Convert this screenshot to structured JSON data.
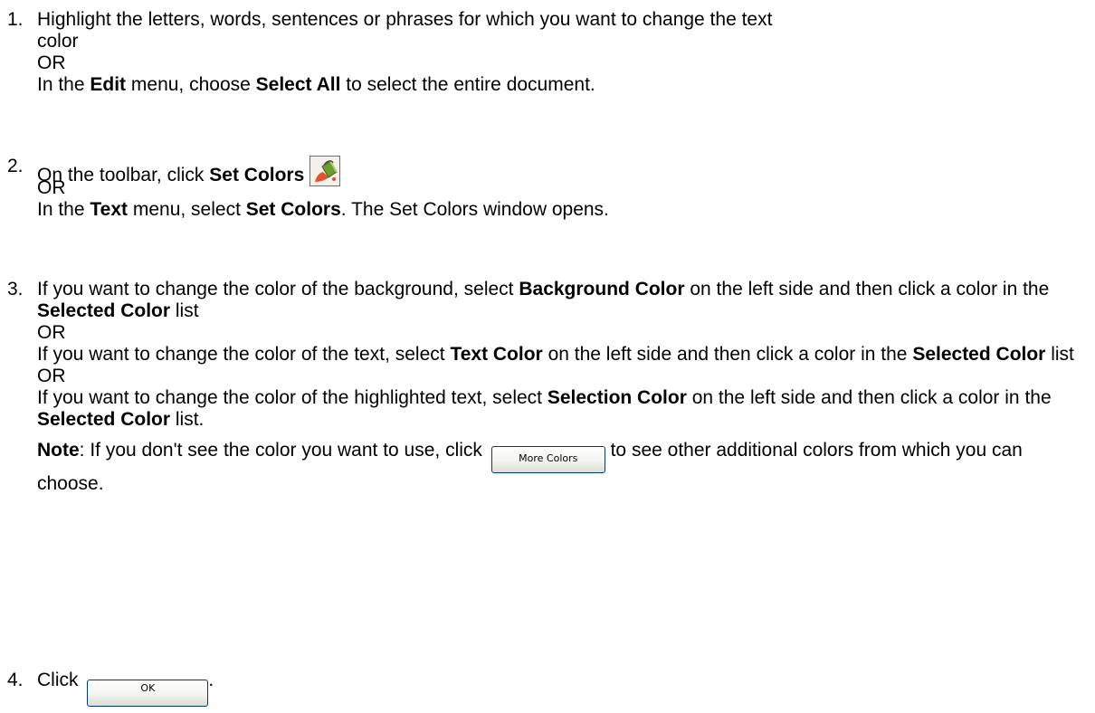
{
  "steps": [
    {
      "number": "1.",
      "line1": "Highlight the letters, words, sentences or phrases for which you want to change the text",
      "line2": "color",
      "or": "OR",
      "line3_pre": "In the ",
      "line3_menu": "Edit",
      "line3_mid": " menu, choose ",
      "line3_cmd": "Select All",
      "line3_post": " to select the entire document."
    },
    {
      "number": "2.",
      "line1_pre": "On the toolbar, click ",
      "line1_cmd": "Set Colors",
      "icon": "paint-bucket-icon",
      "or": "OR",
      "line2_pre": "In the ",
      "line2_menu": "Text",
      "line2_mid": " menu, select ",
      "line2_cmd": "Set Colors",
      "line2_post": ". The Set Colors window opens."
    },
    {
      "number": "3.",
      "a_pre": "If you want to change the color of the background, select ",
      "a_opt": "Background Color",
      "a_mid": " on the left side and then click a color in the ",
      "a_list": "Selected Color",
      "a_post": " list",
      "or1": "OR",
      "b_pre": "If you want to change the color of the text, select ",
      "b_opt": "Text Color",
      "b_mid": " on the left side and then click a color in the ",
      "b_list": "Selected Color",
      "b_post": " list",
      "or2": "OR",
      "c_pre": "If you want to change the color of the highlighted text, select ",
      "c_opt": "Selection Color",
      "c_mid": " on the left side and then click a color in the ",
      "c_list": "Selected Color",
      "c_post": " list.",
      "note_label": "Note",
      "note_pre": ": If you don't see the color you want to use, click ",
      "note_button": "More Colors",
      "note_post": " to see other additional colors from which you can choose."
    },
    {
      "number": "4.",
      "pre": "Click ",
      "button": "OK",
      "post": "."
    }
  ]
}
